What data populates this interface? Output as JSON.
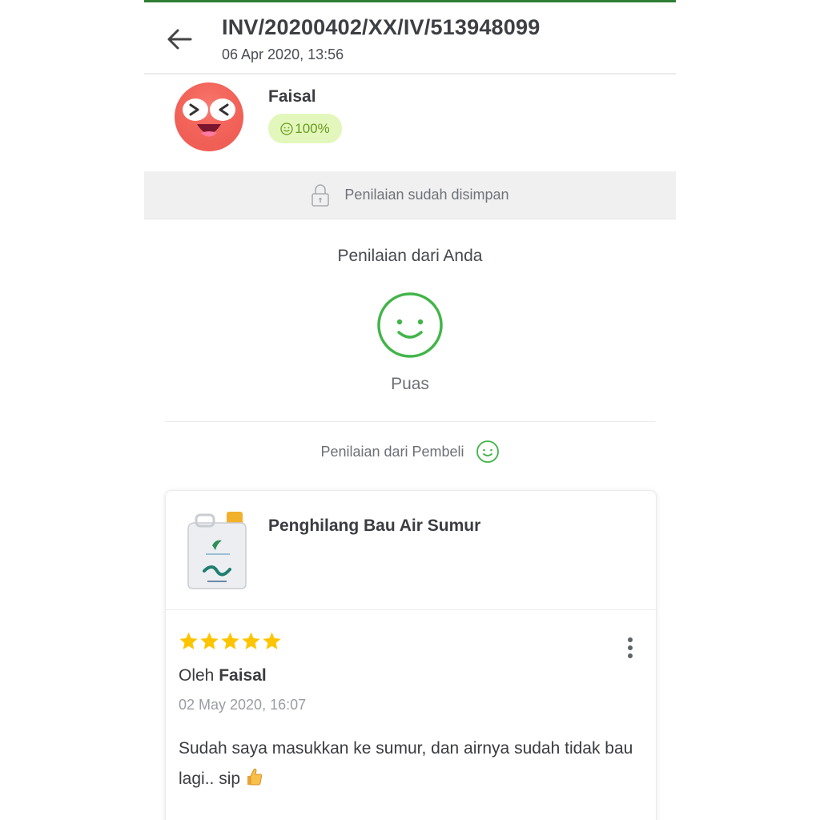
{
  "header": {
    "invoice_number": "INV/20200402/XX/IV/513948099",
    "invoice_date": "06 Apr 2020, 13:56",
    "back_icon": "arrow-left-icon"
  },
  "buyer": {
    "name": "Faisal",
    "reputation_percent": "100%",
    "reputation_icon": "smile-icon",
    "avatar_icon": "laughing-face-avatar"
  },
  "saved_notice": {
    "text": "Penilaian sudah disimpan",
    "icon": "lock-icon"
  },
  "your_rating": {
    "label": "Penilaian dari Anda",
    "value": "Puas",
    "icon": "smile-icon",
    "color": "#42b549"
  },
  "buyer_rating": {
    "label": "Penilaian dari Pembeli",
    "icon": "smile-icon"
  },
  "review": {
    "product_name": "Penghilang Bau Air Sumur",
    "product_image": "product-jerrycan-image",
    "stars": 5,
    "star_color": "#ffc400",
    "by_prefix": "Oleh",
    "author": "Faisal",
    "date": "02 May 2020, 16:07",
    "text": "Sudah saya masukkan ke sumur, dan airnya sudah tidak bau lagi.. sip",
    "emoji": "thumbs-up-emoji",
    "menu_icon": "more-vertical-icon"
  },
  "colors": {
    "accent": "#42b549",
    "top_bar": "#2e7d32",
    "badge_bg": "#e3f7bd",
    "badge_text": "#6b9a1f",
    "star": "#ffc400"
  }
}
